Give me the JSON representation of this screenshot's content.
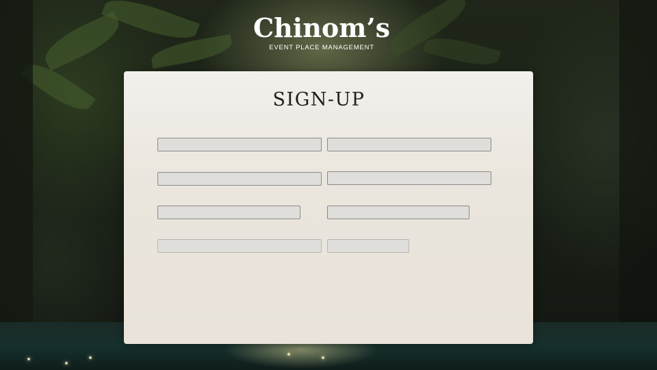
{
  "brand": {
    "name": "Chinom’s",
    "tagline": "EVENT PLACE MANAGEMENT"
  },
  "form": {
    "title": "SIGN-UP",
    "fields": [
      {
        "value": "",
        "placeholder": ""
      },
      {
        "value": "",
        "placeholder": ""
      },
      {
        "value": "",
        "placeholder": ""
      },
      {
        "value": "",
        "placeholder": ""
      },
      {
        "value": "",
        "placeholder": ""
      },
      {
        "value": "",
        "placeholder": ""
      },
      {
        "value": "",
        "placeholder": ""
      },
      {
        "value": "",
        "placeholder": ""
      }
    ]
  },
  "colors": {
    "card_background": "#ebe6dd",
    "field_background": "#dfdedb",
    "field_border": "#8a8a8a",
    "title_text": "#1e1e1e",
    "brand_text": "#ffffff"
  }
}
